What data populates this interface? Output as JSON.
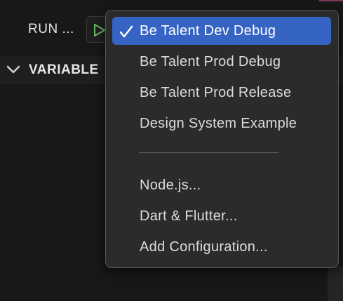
{
  "toolbar": {
    "run_label": "RUN ...",
    "play_icon": "play-icon"
  },
  "sidebar": {
    "variables_label": "VARIABLE",
    "chevron_icon": "chevron-down-icon"
  },
  "menu": {
    "configurations": [
      {
        "label": "Be Talent Dev Debug",
        "selected": true
      },
      {
        "label": "Be Talent Prod Debug",
        "selected": false
      },
      {
        "label": "Be Talent Prod Release",
        "selected": false
      },
      {
        "label": "Design System Example",
        "selected": false
      }
    ],
    "actions": [
      {
        "label": "Node.js..."
      },
      {
        "label": "Dart & Flutter..."
      },
      {
        "label": "Add Configuration..."
      }
    ],
    "check_icon": "check-icon"
  },
  "colors": {
    "background": "#181818",
    "menu_background": "#2b2b2b",
    "selected": "#3664c4",
    "play_green": "#6cc06c"
  }
}
